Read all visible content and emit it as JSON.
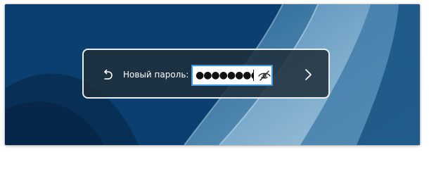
{
  "login": {
    "new_password_label": "Новый пароль:",
    "password_value": "●●●●●●●●",
    "icons": {
      "back": "back-arrow-icon",
      "reveal": "eye-slash-icon",
      "submit": "chevron-right-icon"
    }
  },
  "colors": {
    "background": "#0b3f6f",
    "dialog": "#202e3a",
    "dialog_border": "#e9eef3",
    "field_focus": "#3d9ae0"
  }
}
